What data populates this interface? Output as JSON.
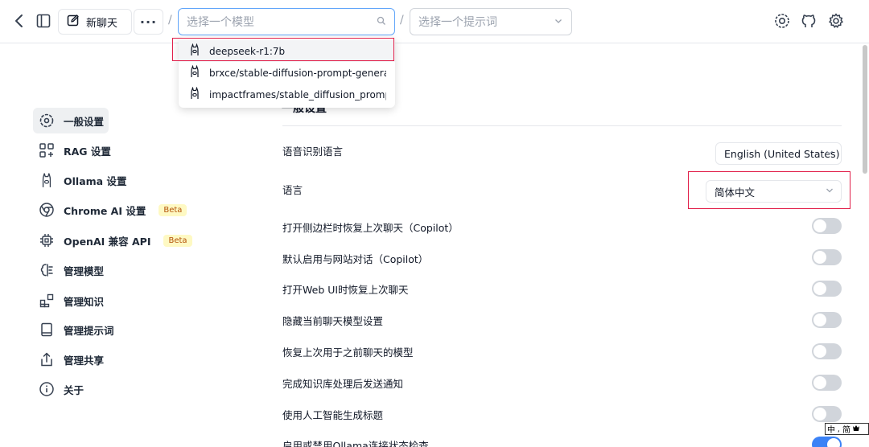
{
  "header": {
    "new_chat_label": "新聊天",
    "more_label": "···",
    "separator": "/",
    "model_select_placeholder": "选择一个模型",
    "prompt_select_placeholder": "选择一个提示词"
  },
  "model_dropdown": {
    "items": [
      {
        "label": "deepseek-r1:7b",
        "icon": "llama-icon",
        "highlighted": true
      },
      {
        "label": "brxce/stable-diffusion-prompt-generator:la",
        "icon": "llama-icon"
      },
      {
        "label": "impactframes/stable_diffusion_prompt_ma",
        "icon": "llama-icon"
      }
    ]
  },
  "sidebar": {
    "items": [
      {
        "label": "一般设置",
        "icon": "settings-general-icon",
        "active": true
      },
      {
        "label": "RAG 设置",
        "icon": "rag-icon"
      },
      {
        "label": "Ollama 设置",
        "icon": "llama-icon"
      },
      {
        "label": "Chrome AI 设置",
        "icon": "chrome-icon",
        "badge": "Beta"
      },
      {
        "label": "OpenAI 兼容 API",
        "icon": "chip-icon",
        "badge": "Beta"
      },
      {
        "label": "管理模型",
        "icon": "brain-icon"
      },
      {
        "label": "管理知识",
        "icon": "blocks-icon"
      },
      {
        "label": "管理提示词",
        "icon": "book-icon"
      },
      {
        "label": "管理共享",
        "icon": "share-icon"
      },
      {
        "label": "关于",
        "icon": "info-icon"
      }
    ]
  },
  "main": {
    "section_title": "一般设置",
    "rows": [
      {
        "label": "语音识别语言",
        "control": "select",
        "value": "English (United States)"
      },
      {
        "label": "语言",
        "control": "select",
        "value": "简体中文"
      },
      {
        "label": "打开侧边栏时恢复上次聊天（Copilot）",
        "control": "toggle",
        "on": false
      },
      {
        "label": "默认启用与网站对话（Copilot）",
        "control": "toggle",
        "on": false
      },
      {
        "label": "打开Web UI时恢复上次聊天",
        "control": "toggle",
        "on": false
      },
      {
        "label": "隐藏当前聊天模型设置",
        "control": "toggle",
        "on": false
      },
      {
        "label": "恢复上次用于之前聊天的模型",
        "control": "toggle",
        "on": false
      },
      {
        "label": "完成知识库处理后发送通知",
        "control": "toggle",
        "on": false
      },
      {
        "label": "使用人工智能生成标题",
        "control": "toggle",
        "on": false
      },
      {
        "label": "启用或禁用Ollama连接状态检查",
        "control": "toggle",
        "on": true
      }
    ]
  },
  "ime_indicator": {
    "text": "中 ⸴ 简"
  },
  "colors": {
    "accent": "#3b82f6",
    "highlight_box": "#e11d48",
    "beta_bg": "#fef9c3"
  }
}
